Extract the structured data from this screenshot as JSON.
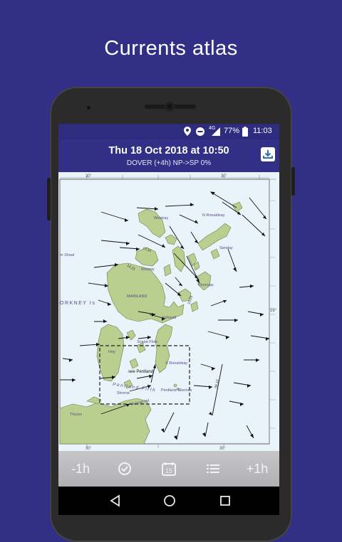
{
  "headline": "Currents atlas",
  "status": {
    "network": "4G",
    "battery": "77%",
    "time": "11:03"
  },
  "header": {
    "title": "Thu 18 Oct 2018 at 10:50",
    "subtitle": "DOVER (+4h) NP->SP 0%"
  },
  "map": {
    "places": {
      "n_ronaldsay": "N Ronaldsay",
      "westray": "Westray",
      "sanday": "Sanday",
      "rousay": "Rousay",
      "stronsay": "Stronsay",
      "mainland": "MAINLAND",
      "orkney": "ORKNEY Is",
      "kirkwall": "Kirkwall",
      "scapa_flow": "Scapa Flow",
      "hoy": "Hoy",
      "s_ronaldsay": "S Ronaldsay",
      "see_pentland": "see Pentland",
      "pentland_firth": "Pentland Firth",
      "pentland_skerries": "Pentland Skerries",
      "stroma": "Stroma",
      "dunnet_head": "Dunnet Hd",
      "thurso": "Thurso",
      "shoal": "m Shoal"
    },
    "rates": {
      "r1": "17,31",
      "r2": "12,21",
      "r3": "15,29",
      "r4": "06,10"
    },
    "ticks": {
      "top_left": "30'",
      "top_right": "30'",
      "right_lat": "59°",
      "bottom_left": "30'",
      "bottom_right": "30'"
    }
  },
  "toolbar": {
    "minus": "-1h",
    "plus": "+1h",
    "calendar_day": "15"
  }
}
